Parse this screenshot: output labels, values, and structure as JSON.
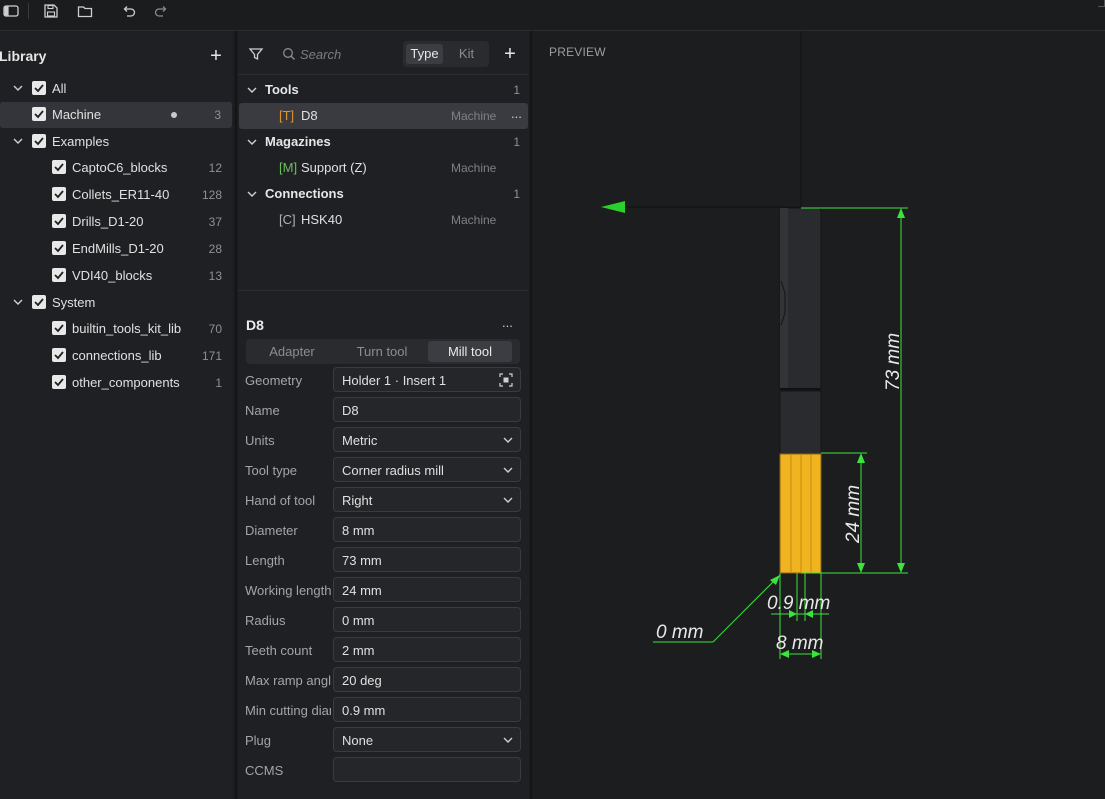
{
  "library": {
    "title": "Library",
    "tree": [
      {
        "label": "All",
        "count": ""
      },
      {
        "label": "Machine",
        "count": "3"
      },
      {
        "label": "Examples",
        "count": ""
      },
      {
        "label": "CaptoC6_blocks",
        "count": "12"
      },
      {
        "label": "Collets_ER11-40",
        "count": "128"
      },
      {
        "label": "Drills_D1-20",
        "count": "37"
      },
      {
        "label": "EndMills_D1-20",
        "count": "28"
      },
      {
        "label": "VDI40_blocks",
        "count": "13"
      },
      {
        "label": "System",
        "count": ""
      },
      {
        "label": "builtin_tools_kit_lib",
        "count": "70"
      },
      {
        "label": "connections_lib",
        "count": "171"
      },
      {
        "label": "other_components",
        "count": "1"
      }
    ]
  },
  "middle": {
    "search_placeholder": "Search",
    "seg_type": "Type",
    "seg_kit": "Kit",
    "groups": [
      {
        "label": "Tools",
        "count": "1",
        "items": [
          {
            "prefix": "[T]",
            "name": "D8",
            "source": "Machine"
          }
        ]
      },
      {
        "label": "Magazines",
        "count": "1",
        "items": [
          {
            "prefix": "[M]",
            "name": "Support (Z)",
            "source": "Machine"
          }
        ]
      },
      {
        "label": "Connections",
        "count": "1",
        "items": [
          {
            "prefix": "[C]",
            "name": "HSK40",
            "source": "Machine"
          }
        ]
      }
    ],
    "more": "...",
    "detail": {
      "title": "D8",
      "tabs": [
        "Adapter",
        "Turn tool",
        "Mill tool"
      ],
      "props": [
        {
          "label": "Geometry",
          "value": "Holder 1 · Insert 1"
        },
        {
          "label": "Name",
          "value": "D8"
        },
        {
          "label": "Units",
          "value": "Metric"
        },
        {
          "label": "Tool type",
          "value": "Corner radius mill"
        },
        {
          "label": "Hand of tool",
          "value": "Right"
        },
        {
          "label": "Diameter",
          "value": "8 mm"
        },
        {
          "label": "Length",
          "value": "73 mm"
        },
        {
          "label": "Working length",
          "value": "24 mm"
        },
        {
          "label": "Radius",
          "value": "0 mm"
        },
        {
          "label": "Teeth count",
          "value": "2 mm"
        },
        {
          "label": "Max ramp angle",
          "value": "20 deg"
        },
        {
          "label": "Min cutting diameter",
          "value": "0.9 mm"
        },
        {
          "label": "Plug",
          "value": "None"
        },
        {
          "label": "CCMS",
          "value": ""
        }
      ]
    }
  },
  "preview": {
    "label": "PREVIEW",
    "dims": {
      "length": "73 mm",
      "working": "24 mm",
      "min_diam": "0.9 mm",
      "radius": "0 mm",
      "diameter": "8 mm"
    }
  },
  "colors": {
    "prefix_tool": "#e0922e",
    "prefix_mag": "#6bbf5a",
    "prefix_conn": "#b0b0b0",
    "dim": "#3de23d",
    "flute": "#f0b420"
  }
}
